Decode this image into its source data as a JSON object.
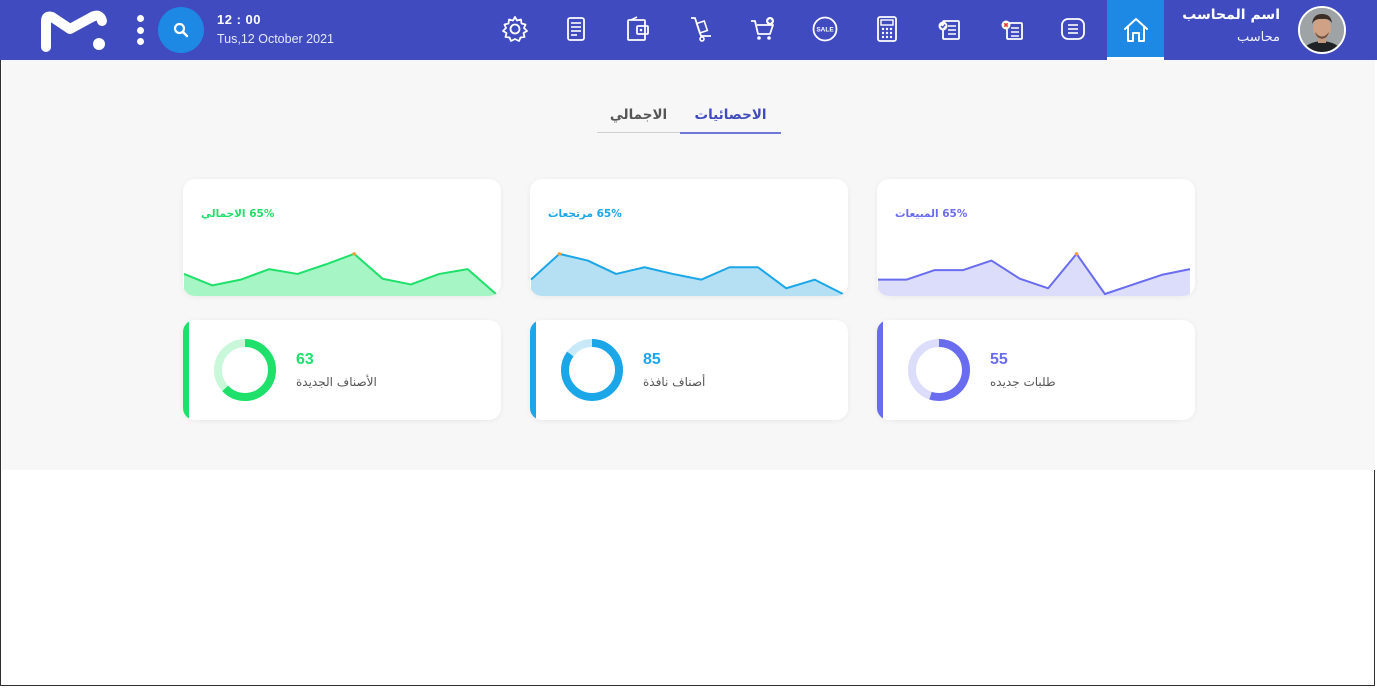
{
  "header": {
    "time": "12 : 00",
    "date": "Tus,12 October 2021",
    "user_name": "اسم المحاسب",
    "user_role": "محاسب",
    "nav_icons": [
      "gear-icon",
      "invoice-icon",
      "wallet-icon",
      "hand-truck-icon",
      "cart-add-icon",
      "sale-tag-icon",
      "calculator-icon",
      "approved-list-icon",
      "rejected-list-icon",
      "list-icon",
      "home-icon"
    ],
    "accent": "#3f4bbf",
    "active_color": "#1e88e5"
  },
  "tabs": {
    "stats_label": "الاحصائيات",
    "total_label": "الاجمالي"
  },
  "charts": [
    {
      "label": "65% المبيعات",
      "color": "#6a6cf0",
      "fill": "#dcddfb"
    },
    {
      "label": "65% مرتجعات",
      "color": "#1ba6e8",
      "fill": "#b5dff3"
    },
    {
      "label": "65% الاجمالي",
      "color": "#1ee06a",
      "fill": "#a6f5c4"
    }
  ],
  "chart_data": [
    {
      "type": "area",
      "title": "65% المبيعات",
      "x": [
        1,
        2,
        3,
        4,
        5,
        6,
        7,
        8,
        9,
        10,
        11,
        12
      ],
      "values": [
        15,
        15,
        25,
        25,
        35,
        16,
        6,
        42,
        0,
        10,
        20,
        26
      ]
    },
    {
      "type": "area",
      "title": "65% مرتجعات",
      "x": [
        1,
        2,
        3,
        4,
        5,
        6,
        7,
        8,
        9,
        10,
        11,
        12
      ],
      "values": [
        15,
        42,
        35,
        21,
        28,
        21,
        15,
        28,
        28,
        6,
        15,
        0
      ]
    },
    {
      "type": "area",
      "title": "65% الاجمالي",
      "x": [
        1,
        2,
        3,
        4,
        5,
        6,
        7,
        8,
        9,
        10,
        11,
        12
      ],
      "values": [
        21,
        9,
        15,
        26,
        21,
        31,
        42,
        16,
        10,
        21,
        26,
        0
      ]
    }
  ],
  "stats": [
    {
      "value": "55",
      "label": "طلبات جديده",
      "color": "#6a6cf0",
      "track": "#dcddfb",
      "fraction": 0.55
    },
    {
      "value": "85",
      "label": "أصناف نافذة",
      "color": "#1ba6e8",
      "track": "#c8e9f8",
      "fraction": 0.85
    },
    {
      "value": "63",
      "label": "الأصناف الجديدة",
      "color": "#1ee06a",
      "track": "#c8f7da",
      "fraction": 0.63
    }
  ]
}
